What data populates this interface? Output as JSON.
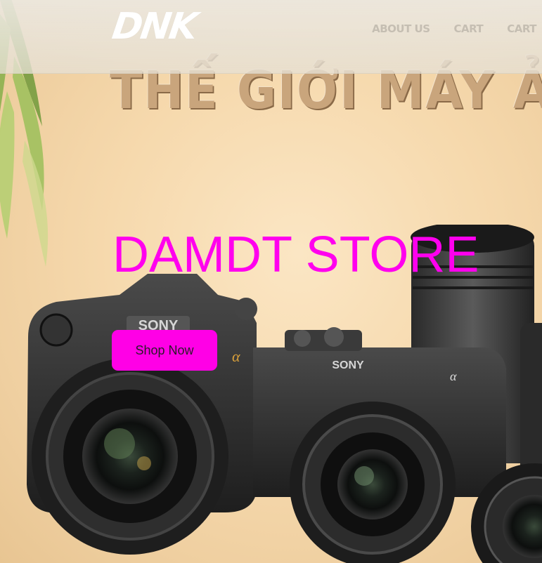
{
  "nav": {
    "logo": "DNK",
    "links": [
      {
        "label": "ABOUT US"
      },
      {
        "label": "CART"
      },
      {
        "label": "CART"
      }
    ]
  },
  "hero": {
    "banner_text": "THẾ GIỚI MÁY Ả",
    "title": "DAMDT STORE",
    "cta_label": "Shop Now",
    "camera_brand_1": "SONY",
    "camera_brand_2": "SONY",
    "camera_model_mark": "α",
    "title_color": "#ff00ee",
    "button_color": "#ff00e6"
  }
}
